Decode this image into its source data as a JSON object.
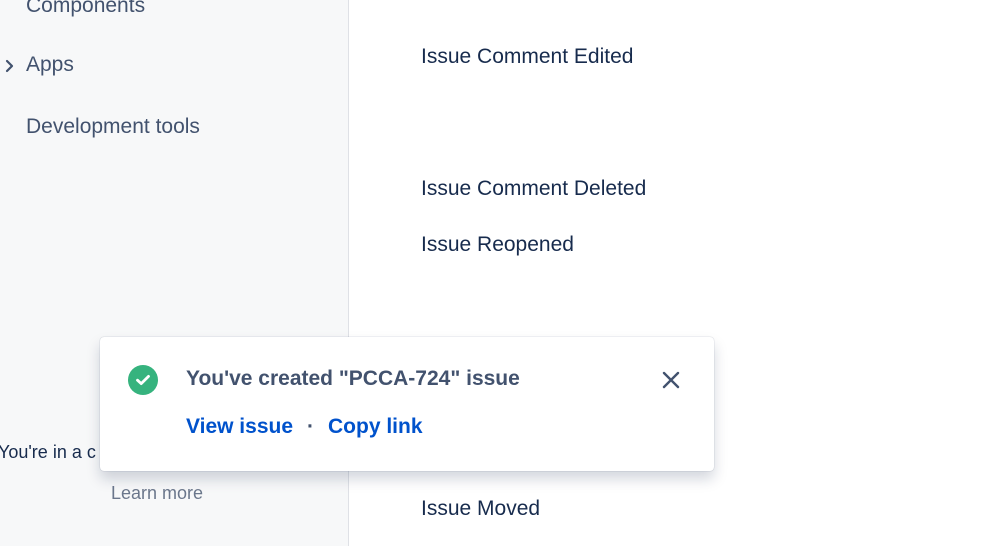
{
  "sidebar": {
    "items": [
      {
        "label": "Components"
      },
      {
        "label": "Apps"
      },
      {
        "label": "Development tools"
      }
    ],
    "note": "You're in a c",
    "learn_more": "Learn more"
  },
  "main": {
    "events": [
      {
        "label": "Issue Comment Edited"
      },
      {
        "label": "Issue Comment Deleted"
      },
      {
        "label": "Issue Reopened"
      },
      {
        "label": "Issue Moved"
      }
    ]
  },
  "flag": {
    "title": "You've created \"PCCA-724\" issue",
    "view_issue": "View issue",
    "separator": "·",
    "copy_link": "Copy link",
    "icon": "check-circle-icon",
    "success_color": "#36b37e"
  }
}
